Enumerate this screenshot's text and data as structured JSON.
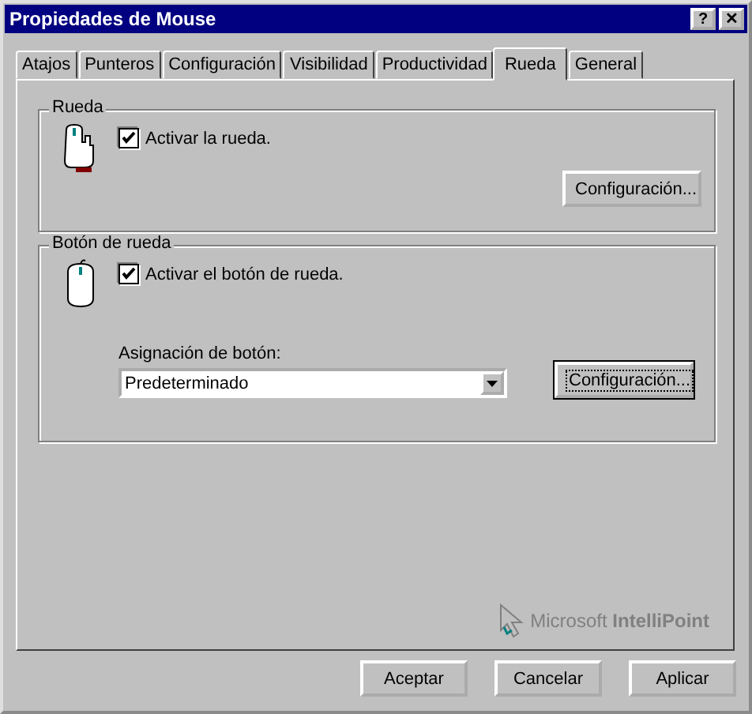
{
  "window": {
    "title": "Propiedades de Mouse",
    "help_button": "?",
    "close_button": "✕"
  },
  "tabs": [
    {
      "label": "Atajos",
      "selected": false
    },
    {
      "label": "Punteros",
      "selected": false
    },
    {
      "label": "Configuración",
      "selected": false
    },
    {
      "label": "Visibilidad",
      "selected": false
    },
    {
      "label": "Productividad",
      "selected": false
    },
    {
      "label": "Rueda",
      "selected": true
    },
    {
      "label": "General",
      "selected": false
    }
  ],
  "wheel_group": {
    "title": "Rueda",
    "checkbox": {
      "label": "Activar la rueda.",
      "checked": true
    },
    "button": "Configuración..."
  },
  "wheel_button_group": {
    "title": "Botón de rueda",
    "checkbox": {
      "label": "Activar el botón de rueda.",
      "checked": true
    },
    "assignment_label": "Asignación de botón:",
    "assignment_value": "Predeterminado",
    "button": "Configuración...",
    "button_focused": true
  },
  "brand": "Microsoft **IntelliPoint**",
  "buttons": [
    "Aceptar",
    "Cancelar",
    "Aplicar"
  ]
}
